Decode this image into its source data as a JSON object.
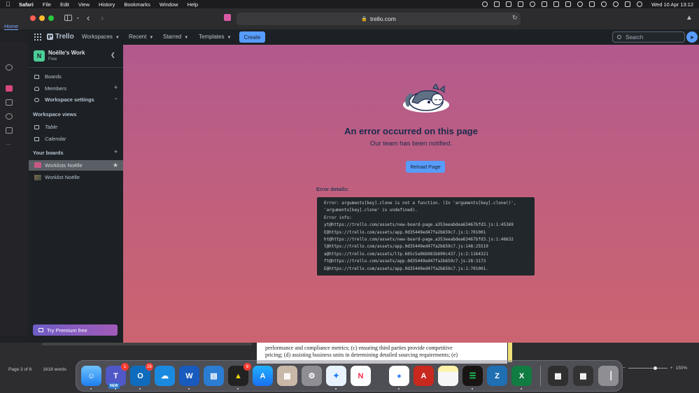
{
  "menubar": {
    "app": "Safari",
    "items": [
      "File",
      "Edit",
      "View",
      "History",
      "Bookmarks",
      "Window",
      "Help"
    ],
    "clock": "Wed 10 Apr  13:12"
  },
  "browser": {
    "url": "trello.com",
    "bg_tab": "Home"
  },
  "trello": {
    "logo": "Trello",
    "nav": [
      "Workspaces",
      "Recent",
      "Starred",
      "Templates"
    ],
    "create_label": "Create",
    "search_placeholder": "Search"
  },
  "sidebar": {
    "workspace_initial": "N",
    "workspace_name": "Noëlle's Work",
    "workspace_plan": "Free",
    "items": {
      "boards": "Boards",
      "members": "Members",
      "settings": "Workspace settings"
    },
    "views_heading": "Workspace views",
    "views": [
      "Table",
      "Calendar"
    ],
    "your_boards_heading": "Your boards",
    "boards": [
      "Worklists Noëlle",
      "Worklist Noëlle"
    ],
    "premium_label": "Try Premium free"
  },
  "error": {
    "title": "An error occurred on this page",
    "subtitle": "Our team has been notified.",
    "reload_label": "Reload Page",
    "details_label": "Error details:",
    "lines": [
      "Error: arguments[key].clone is not a function. (In 'arguments[key].clone()',",
      "'arguments[key].clone' is undefined).",
      "Error info:",
      "yt@https://trello.com/assets/new-board-page.a353eeabdea63467bfd3.js:1:45369",
      "E@https://trello.com/assets/app.0d35449ed47fa2b659c7.js:1:701001",
      "ht@https://trello.com/assets/new-board-page.a353eeabdea63467bfd3.js:1:46632",
      "l@https://trello.com/assets/app.0d35449ed47fa2b659c7.js:148:25510",
      "a@https://trello.com/assets/ltp.665c5a96b981b690c437.js:2:1164321",
      "ft@https://trello.com/assets/app.0d35449ed47fa2b659c7.js:28:3173",
      "E@https://trello.com/assets/app.0d35449ed47fa2b659c7.js:1:701001."
    ]
  },
  "word": {
    "text_line1": "performance and compliance metrics; (c) ensuring third parties provide competitive",
    "text_line2": "pricing; (d) assisting business units in determining detailed sourcing requirements; (e)",
    "page_status": "Page 3 of 6",
    "word_count": "1618 words",
    "zoom": "150%"
  },
  "dock": {
    "teams_badge": "1",
    "teams_new": "NEW",
    "outlook_badge": "26",
    "app8_badge": "8"
  }
}
